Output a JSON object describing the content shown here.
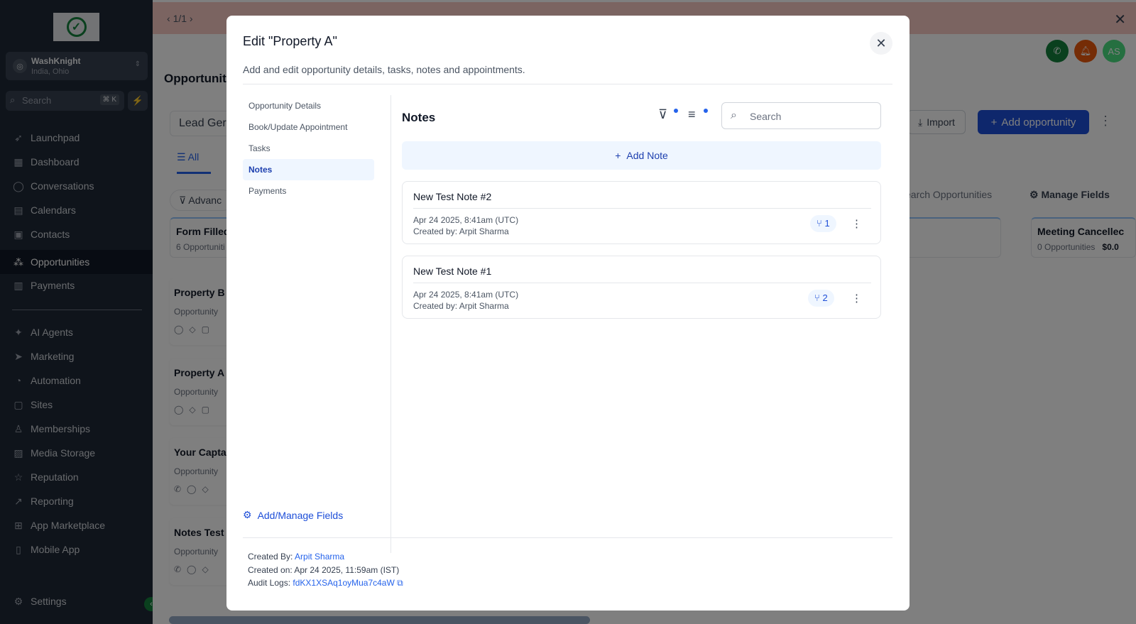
{
  "sidebar": {
    "account": {
      "name": "WashKnight",
      "location": "India, Ohio"
    },
    "search": {
      "placeholder": "Search",
      "shortcut": "⌘ K"
    },
    "items_top": [
      {
        "label": "Launchpad",
        "icon": "rocket-icon"
      },
      {
        "label": "Dashboard",
        "icon": "grid-icon"
      },
      {
        "label": "Conversations",
        "icon": "chat-icon"
      },
      {
        "label": "Calendars",
        "icon": "calendar-icon"
      },
      {
        "label": "Contacts",
        "icon": "contacts-icon"
      },
      {
        "label": "Opportunities",
        "icon": "opportunities-icon"
      },
      {
        "label": "Payments",
        "icon": "payments-icon"
      }
    ],
    "items_bottom": [
      {
        "label": "AI Agents",
        "icon": "sparkle-icon"
      },
      {
        "label": "Marketing",
        "icon": "send-icon"
      },
      {
        "label": "Automation",
        "icon": "automation-icon"
      },
      {
        "label": "Sites",
        "icon": "sites-icon"
      },
      {
        "label": "Memberships",
        "icon": "membership-icon"
      },
      {
        "label": "Media Storage",
        "icon": "image-icon"
      },
      {
        "label": "Reputation",
        "icon": "star-icon"
      },
      {
        "label": "Reporting",
        "icon": "chart-icon"
      },
      {
        "label": "App Marketplace",
        "icon": "apps-icon"
      },
      {
        "label": "Mobile App",
        "icon": "mobile-icon"
      }
    ],
    "settings_label": "Settings",
    "active_item": "Opportunities"
  },
  "banner": {
    "pagination": "1/1"
  },
  "header": {
    "avatar_initials": "AS"
  },
  "page": {
    "title": "Opportuniti",
    "pipeline": "Lead Ger",
    "tab_all": "All",
    "advanced_label": "Advanc",
    "import_label": "Import",
    "add_opportunity_label": "Add opportunity",
    "search_opportunities": "earch Opportunities",
    "manage_fields_label": "Manage Fields",
    "columns": [
      {
        "title": "Form Filled",
        "sub": "6 Opportuniti"
      },
      {
        "title": "Meeting Cancellec",
        "sub": "0 Opportunities",
        "amount": "$0.0"
      }
    ],
    "cards": [
      {
        "name": "Property B",
        "sub": "Opportunity"
      },
      {
        "name": "Property A",
        "sub": "Opportunity"
      },
      {
        "name": "Your Capta",
        "sub": "Opportunity"
      },
      {
        "name": "Notes Test",
        "sub": "Opportunity"
      }
    ]
  },
  "modal": {
    "title": "Edit \"Property A\"",
    "subtitle": "Add and edit opportunity details, tasks, notes and appointments.",
    "tabs": [
      "Opportunity Details",
      "Book/Update Appointment",
      "Tasks",
      "Notes",
      "Payments"
    ],
    "active_tab": "Notes",
    "manage_fields": "Add/Manage Fields",
    "notes": {
      "heading": "Notes",
      "search_placeholder": "Search",
      "add_label": "Add Note",
      "items": [
        {
          "title": "New Test Note #2",
          "date": "Apr 24 2025, 8:41am (UTC)",
          "created_by": "Created by: Arpit Sharma",
          "count": "1"
        },
        {
          "title": "New Test Note #1",
          "date": "Apr 24 2025, 8:41am (UTC)",
          "created_by": "Created by: Arpit Sharma",
          "count": "2"
        }
      ]
    },
    "footer": {
      "created_by_label": "Created By:",
      "created_by_value": "Arpit Sharma",
      "created_on": "Created on: Apr 24 2025, 11:59am (IST)",
      "audit_label": "Audit Logs:",
      "audit_value": "fdKX1XSAq1oyMua7c4aW"
    }
  },
  "colors": {
    "accent": "#1d4ed8",
    "sidebar_bg": "#1f2937",
    "banner_bg": "#f7c9c2",
    "green": "#15803d"
  }
}
